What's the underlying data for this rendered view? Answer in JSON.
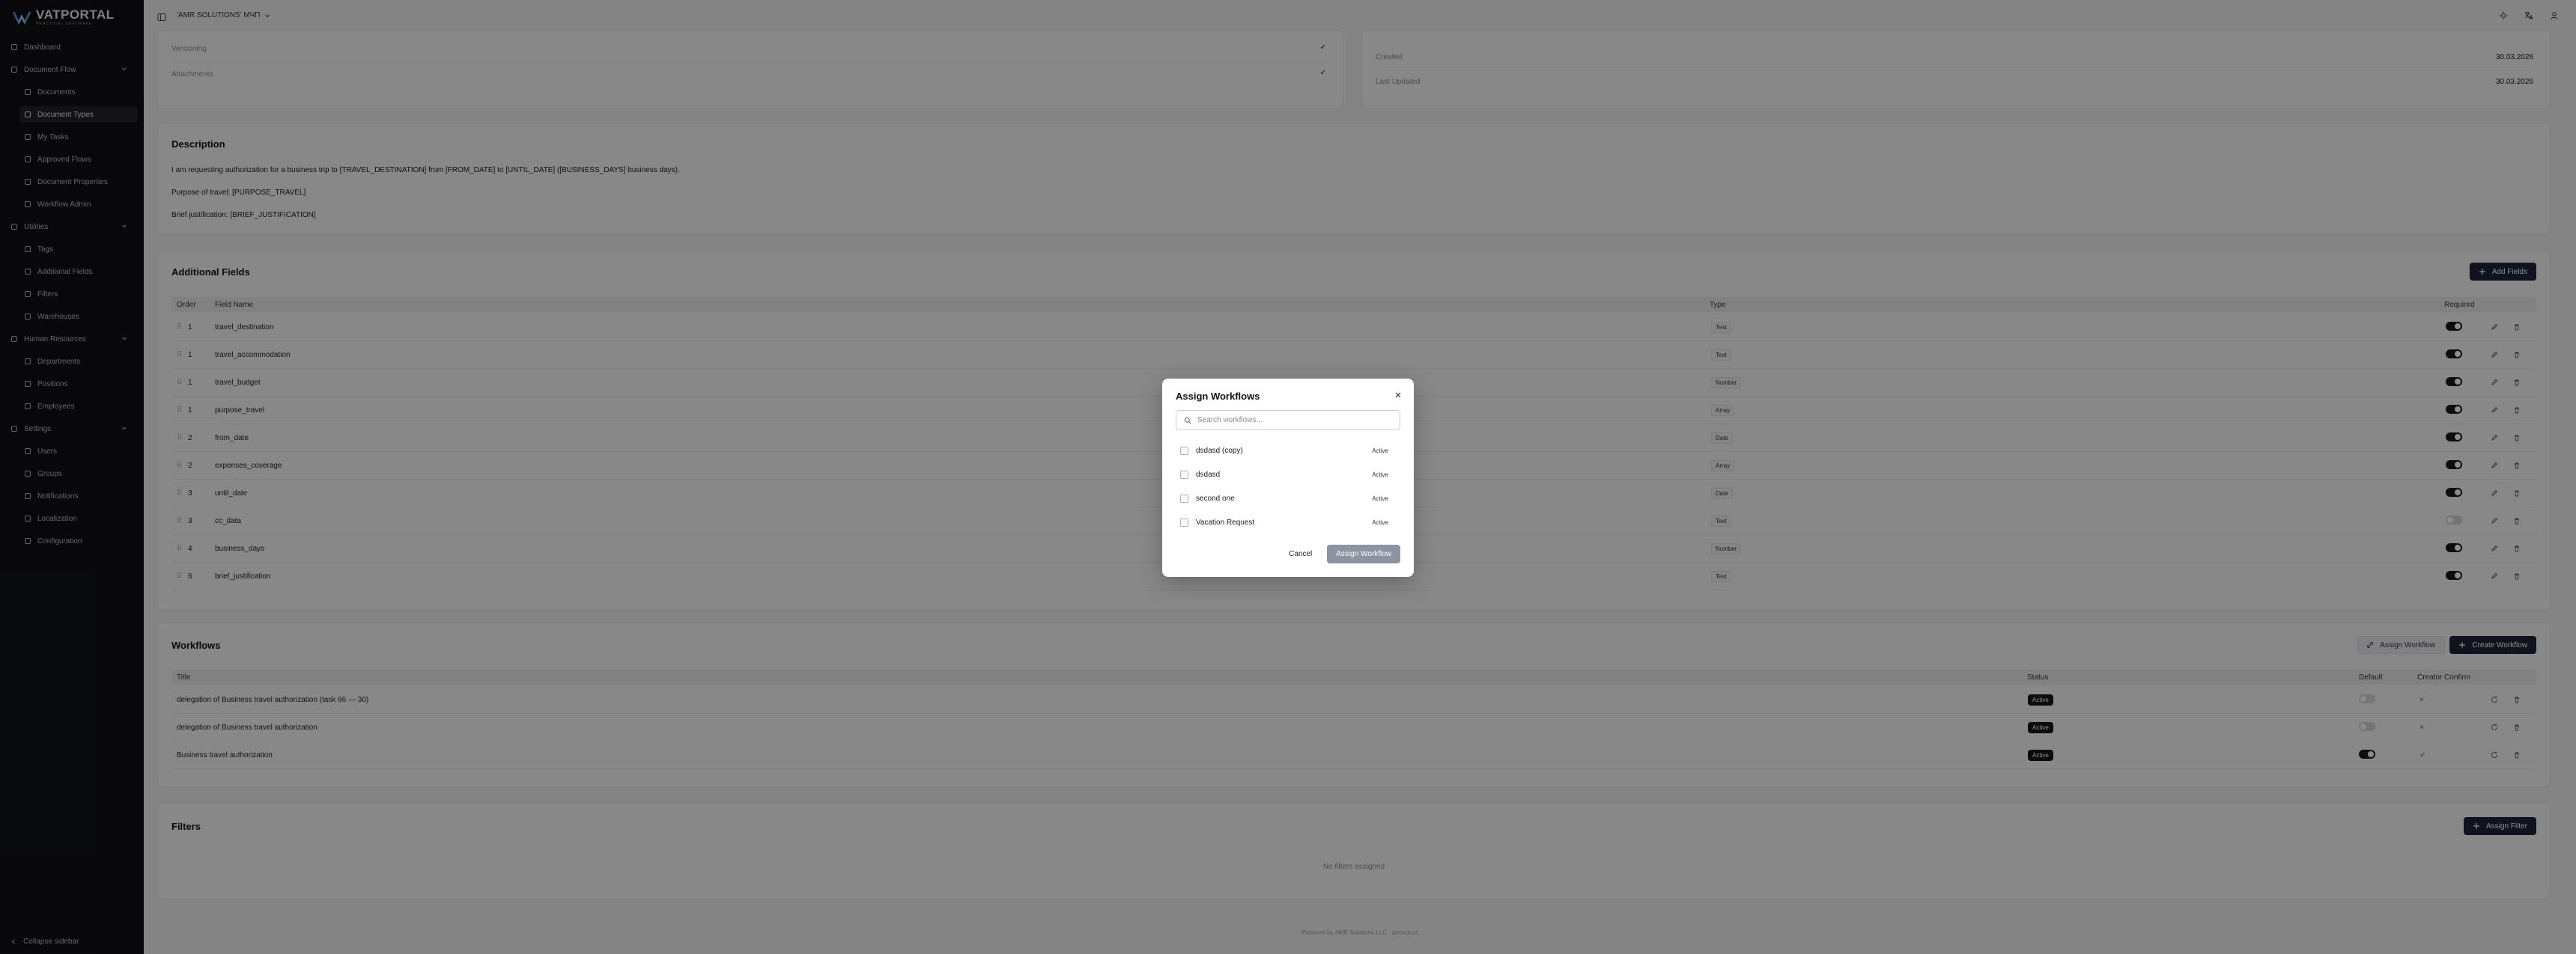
{
  "app": {
    "brand": "VATPORTAL",
    "brand_tagline": "PRACTICAL SOFTWARE",
    "org_name": "'AMR SOLUTIONS' МЧП"
  },
  "sidebar": {
    "items": [
      {
        "label": "Dashboard",
        "icon": "home-icon"
      },
      {
        "label": "Document Flow",
        "icon": "folder-icon"
      },
      {
        "label": "Documents",
        "icon": "file-icon"
      },
      {
        "label": "Document Types",
        "icon": "file-type-icon"
      },
      {
        "label": "My Tasks",
        "icon": "tasks-icon"
      },
      {
        "label": "Approved Flows",
        "icon": "flow-icon"
      },
      {
        "label": "Document Properties",
        "icon": "properties-icon"
      },
      {
        "label": "Workflow Admin",
        "icon": "workflow-icon"
      },
      {
        "label": "Utilities",
        "icon": "wrench-icon"
      },
      {
        "label": "Tags",
        "icon": "tag-icon"
      },
      {
        "label": "Additional Fields",
        "icon": "fields-icon"
      },
      {
        "label": "Filters",
        "icon": "filter-icon"
      },
      {
        "label": "Warehouses",
        "icon": "warehouse-icon"
      },
      {
        "label": "Human Resources",
        "icon": "users-icon"
      },
      {
        "label": "Departments",
        "icon": "building-icon"
      },
      {
        "label": "Positions",
        "icon": "position-icon"
      },
      {
        "label": "Employees",
        "icon": "employee-icon"
      },
      {
        "label": "Settings",
        "icon": "gear-icon"
      },
      {
        "label": "Users",
        "icon": "user-icon"
      },
      {
        "label": "Groups",
        "icon": "group-icon"
      },
      {
        "label": "Notifications",
        "icon": "bell-icon"
      },
      {
        "label": "Localization",
        "icon": "language-icon"
      },
      {
        "label": "Configuration",
        "icon": "config-icon"
      }
    ],
    "collapse_label": "Collapse sidebar"
  },
  "info": {
    "versioning_label": "Versioning",
    "attachments_label": "Attachments",
    "created_label": "Created",
    "created_value": "30.03.2026",
    "updated_label": "Last Updated",
    "updated_value": "30.03.2026"
  },
  "description": {
    "title": "Description",
    "line1": "I am requesting authorization for a business trip to [TRAVEL_DESTINATION] from [FROM_DATE] to [UNTIL_DATE] ([BUSINESS_DAYS] business days).",
    "line2": "Purpose of travel: [PURPOSE_TRAVEL]",
    "line3": "Brief justification: [BRIEF_JUSTIFICATION]"
  },
  "fields": {
    "title": "Additional Fields",
    "add_button": "Add Fields",
    "headers": {
      "order": "Order",
      "name": "Field Name",
      "type": "Type",
      "required": "Required"
    },
    "rows": [
      {
        "order": "1",
        "name": "travel_destination",
        "type": "Text",
        "required": true
      },
      {
        "order": "1",
        "name": "travel_accommodation",
        "type": "Text",
        "required": true
      },
      {
        "order": "1",
        "name": "travel_budget",
        "type": "Number",
        "required": true
      },
      {
        "order": "1",
        "name": "purpose_travel",
        "type": "Array",
        "required": true
      },
      {
        "order": "2",
        "name": "from_date",
        "type": "Date",
        "required": true
      },
      {
        "order": "2",
        "name": "expenses_coverage",
        "type": "Array",
        "required": true
      },
      {
        "order": "3",
        "name": "until_date",
        "type": "Date",
        "required": true
      },
      {
        "order": "3",
        "name": "cc_data",
        "type": "Text",
        "required": false
      },
      {
        "order": "4",
        "name": "business_days",
        "type": "Number",
        "required": true
      },
      {
        "order": "6",
        "name": "brief_justification",
        "type": "Text",
        "required": true
      }
    ]
  },
  "workflows": {
    "title": "Workflows",
    "assign_button": "Assign Workflow",
    "create_button": "Create Workflow",
    "headers": {
      "title": "Title",
      "status": "Status",
      "default": "Default",
      "creator_confirm": "Creator Confirm"
    },
    "rows": [
      {
        "title": "delegation of Business travel authorization (task 66 — 30)",
        "status": "Active",
        "default": false,
        "confirm": "×"
      },
      {
        "title": "delegation of Business travel authorization",
        "status": "Active",
        "default": false,
        "confirm": "×"
      },
      {
        "title": "Business travel authorization",
        "status": "Active",
        "default": true,
        "confirm": "✓"
      }
    ]
  },
  "filters": {
    "title": "Filters",
    "assign_button": "Assign Filter",
    "empty": "No filters assigned"
  },
  "footer": "Powered by AMR Solutions LLC · amrsol.uz",
  "modal": {
    "title": "Assign Workflows",
    "search_placeholder": "Search workflows...",
    "items": [
      {
        "label": "dsdasd (copy)",
        "status": "Active"
      },
      {
        "label": "dsdasd",
        "status": "Active"
      },
      {
        "label": "second one",
        "status": "Active"
      },
      {
        "label": "Vacation Request",
        "status": "Active"
      }
    ],
    "cancel": "Cancel",
    "assign": "Assign Workflow"
  }
}
